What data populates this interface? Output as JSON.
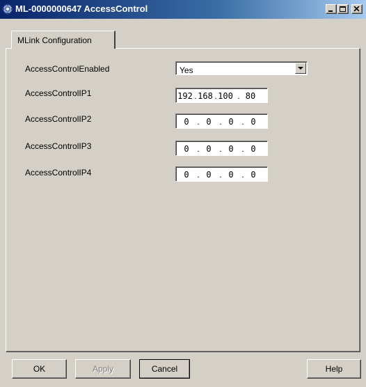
{
  "window": {
    "title": "ML-0000000647 AccessControl",
    "controls": [
      "minimize-icon",
      "maximize-icon",
      "close-icon"
    ]
  },
  "tabs": [
    {
      "label": "MLink Configuration",
      "active": true
    }
  ],
  "fields": {
    "enabled": {
      "label": "AccessControlEnabled",
      "value": "Yes"
    },
    "ip1": {
      "label": "AccessControlIP1",
      "octets": [
        "192",
        "168",
        "100",
        "80"
      ]
    },
    "ip2": {
      "label": "AccessControlIP2",
      "octets": [
        "0",
        "0",
        "0",
        "0"
      ]
    },
    "ip3": {
      "label": "AccessControlIP3",
      "octets": [
        "0",
        "0",
        "0",
        "0"
      ]
    },
    "ip4": {
      "label": "AccessControlIP4",
      "octets": [
        "0",
        "0",
        "0",
        "0"
      ]
    }
  },
  "buttons": {
    "ok": "OK",
    "apply": "Apply",
    "cancel": "Cancel",
    "help": "Help"
  },
  "colors": {
    "titlebar_start": "#0a246a",
    "titlebar_end": "#a6caf0",
    "face": "#d4d0c8"
  }
}
